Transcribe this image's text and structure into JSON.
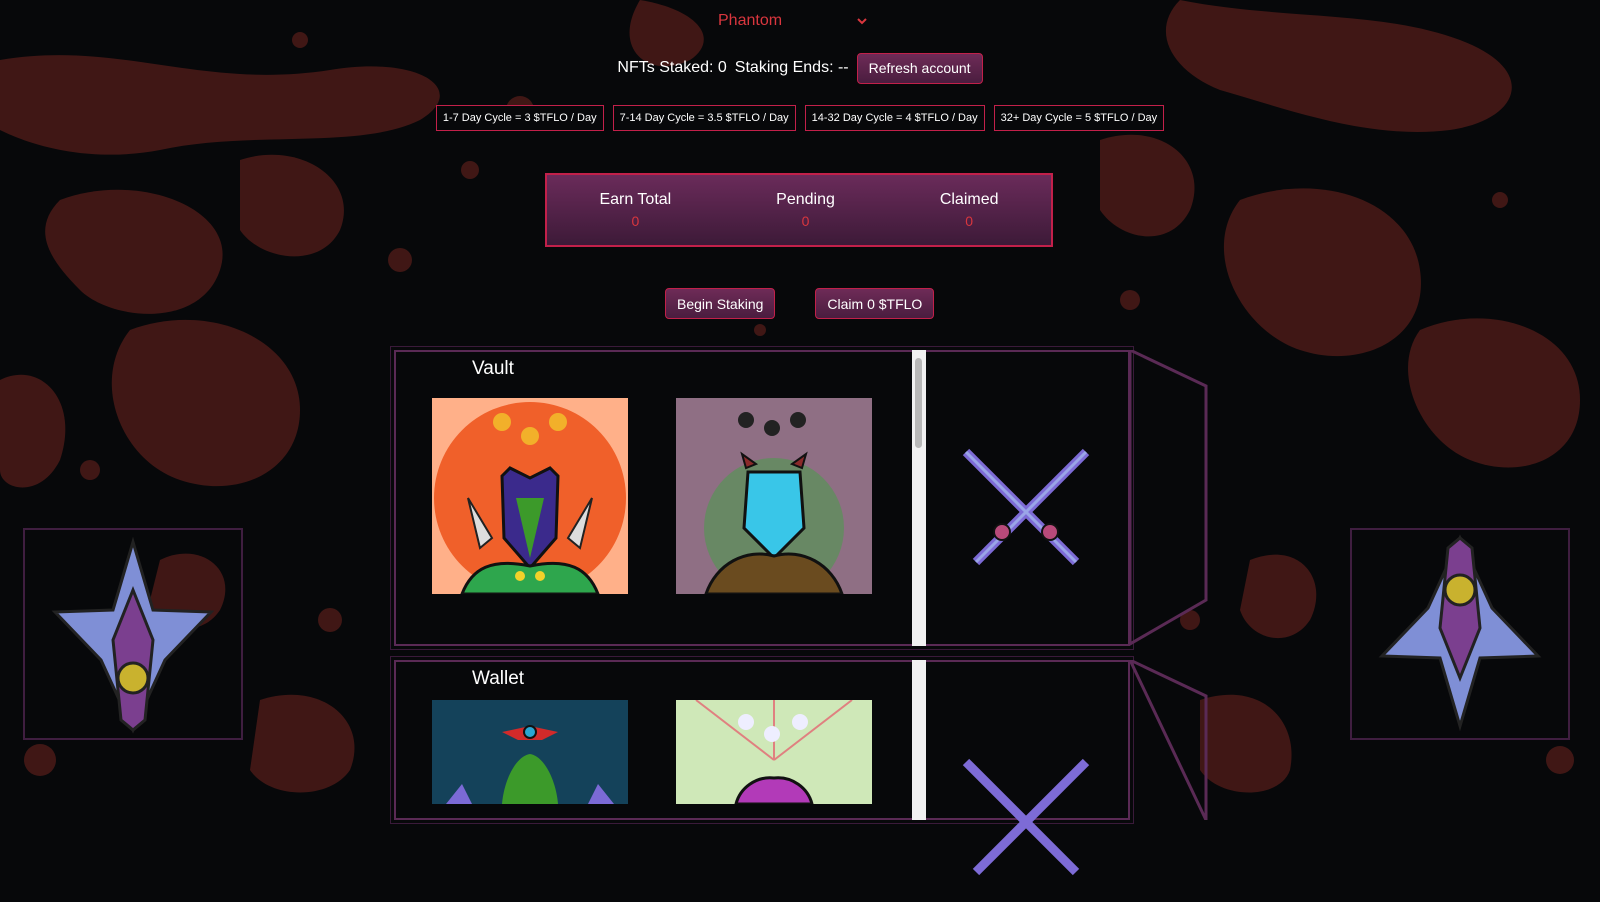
{
  "wallet": {
    "selected": "Phantom"
  },
  "status": {
    "nfts_staked_label": "NFTs Staked: 0",
    "staking_ends_label": "Staking Ends: --",
    "refresh_button": "Refresh account"
  },
  "cycles": [
    "1-7 Day Cycle = 3 $TFLO / Day",
    "7-14 Day Cycle = 3.5 $TFLO / Day",
    "14-32 Day Cycle = 4 $TFLO / Day",
    "32+ Day Cycle = 5 $TFLO / Day"
  ],
  "earnings": {
    "earn_total_label": "Earn Total",
    "earn_total_value": "0",
    "pending_label": "Pending",
    "pending_value": "0",
    "claimed_label": "Claimed",
    "claimed_value": "0"
  },
  "actions": {
    "begin_staking": "Begin Staking",
    "claim": "Claim 0 $TFLO"
  },
  "vault": {
    "title": "Vault"
  },
  "wallet_panel": {
    "title": "Wallet"
  },
  "colors": {
    "accent_red": "#c2204a",
    "text_red": "#d9363e",
    "purple": "#6a2b5a"
  },
  "icons": [
    "chevron-down-icon",
    "crossed-swords-icon",
    "pendant-icon"
  ]
}
